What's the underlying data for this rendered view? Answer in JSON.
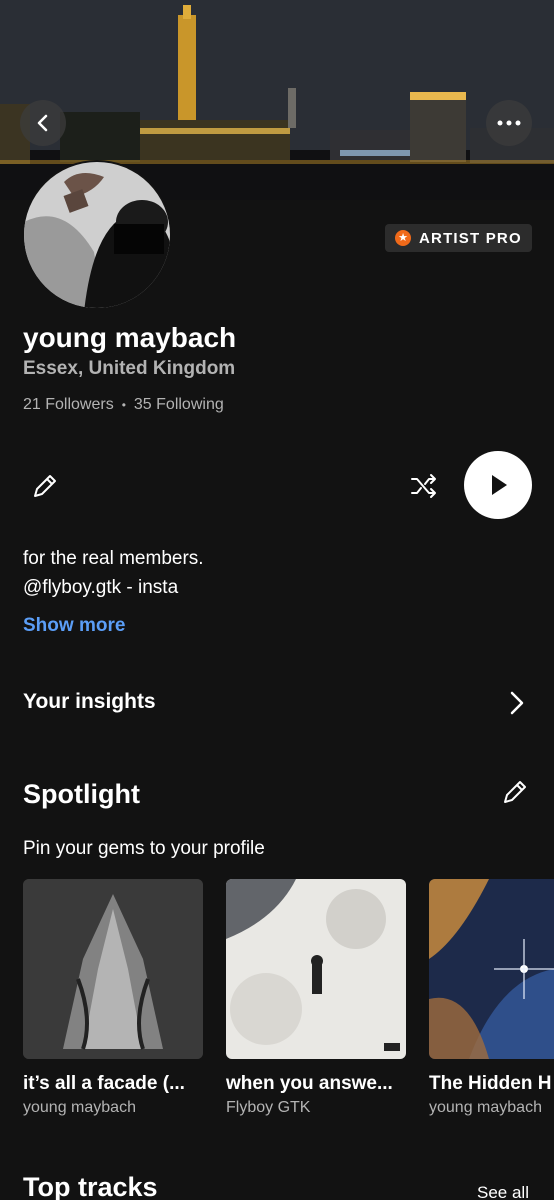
{
  "badge": {
    "label": "ARTIST PRO",
    "color": "#f06a1a"
  },
  "profile": {
    "name": "young maybach",
    "location": "Essex, United Kingdom",
    "followers": "21 Followers",
    "following": "35 Following"
  },
  "bio": {
    "line1": "for the real members.",
    "line2": "@flyboy.gtk - insta",
    "show_more": "Show more"
  },
  "insights": {
    "label": "Your insights"
  },
  "spotlight": {
    "title": "Spotlight",
    "subtitle": "Pin your gems to your profile",
    "items": [
      {
        "title": "it’s all a facade (...",
        "artist": "young maybach"
      },
      {
        "title": "when you answe...",
        "artist": "Flyboy GTK"
      },
      {
        "title": "The Hidden H",
        "artist": "young maybach"
      }
    ]
  },
  "top_tracks": {
    "title": "Top tracks",
    "see_all": "See all"
  },
  "colors": {
    "accent_link": "#5b9ef7",
    "background": "#121212"
  },
  "icons": [
    "back-arrow-icon",
    "more-dots-icon",
    "star-icon",
    "pencil-icon",
    "shuffle-icon",
    "play-icon",
    "chevron-right-icon"
  ]
}
